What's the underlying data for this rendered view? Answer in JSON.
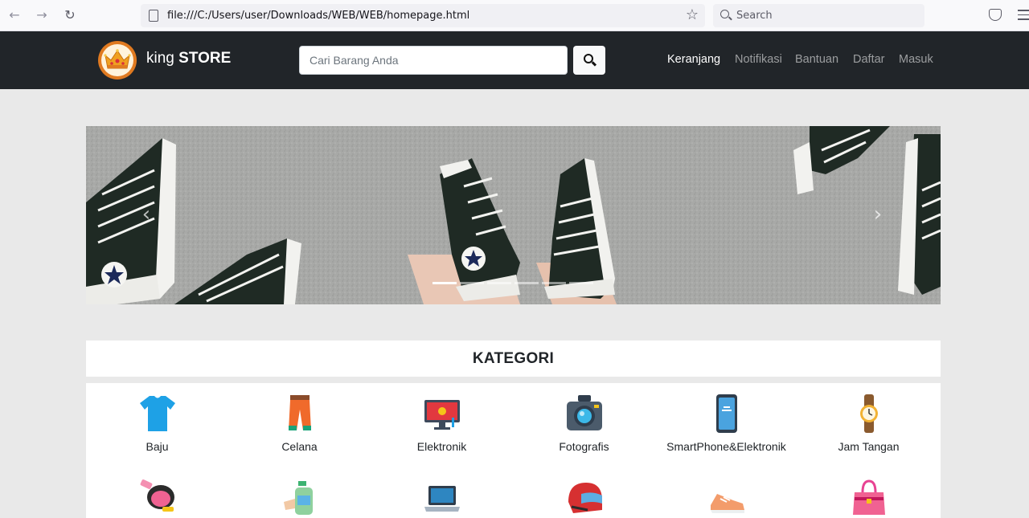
{
  "browser": {
    "url": "file:///C:/Users/user/Downloads/WEB/WEB/homepage.html",
    "search_placeholder": "Search"
  },
  "header": {
    "brand_light": "king",
    "brand_bold": "STORE",
    "search_placeholder": "Cari Barang Anda",
    "nav": [
      "Keranjang",
      "Notifikasi",
      "Bantuan",
      "Daftar",
      "Masuk"
    ],
    "active_nav": "Keranjang"
  },
  "carousel": {
    "slide_count": 6,
    "active_slide": 1
  },
  "kategori": {
    "title": "KATEGORI",
    "items": [
      {
        "label": "Baju",
        "icon": "tshirt-icon"
      },
      {
        "label": "Celana",
        "icon": "trousers-icon"
      },
      {
        "label": "Elektronik",
        "icon": "monitor-icon"
      },
      {
        "label": "Fotografis",
        "icon": "camera-icon"
      },
      {
        "label": "SmartPhone&Elektronik",
        "icon": "smartphone-icon"
      },
      {
        "label": "Jam Tangan",
        "icon": "wristwatch-icon"
      },
      {
        "label": "",
        "icon": "makeup-compact-icon"
      },
      {
        "label": "",
        "icon": "hand-sanitizer-icon"
      },
      {
        "label": "",
        "icon": "laptop-icon"
      },
      {
        "label": "",
        "icon": "helmet-icon"
      },
      {
        "label": "",
        "icon": "sneaker-icon"
      },
      {
        "label": "",
        "icon": "handbag-icon"
      }
    ]
  },
  "colors": {
    "header_bg": "#212529",
    "page_bg": "#e9e9e9",
    "logo_orange": "#e07a20"
  }
}
